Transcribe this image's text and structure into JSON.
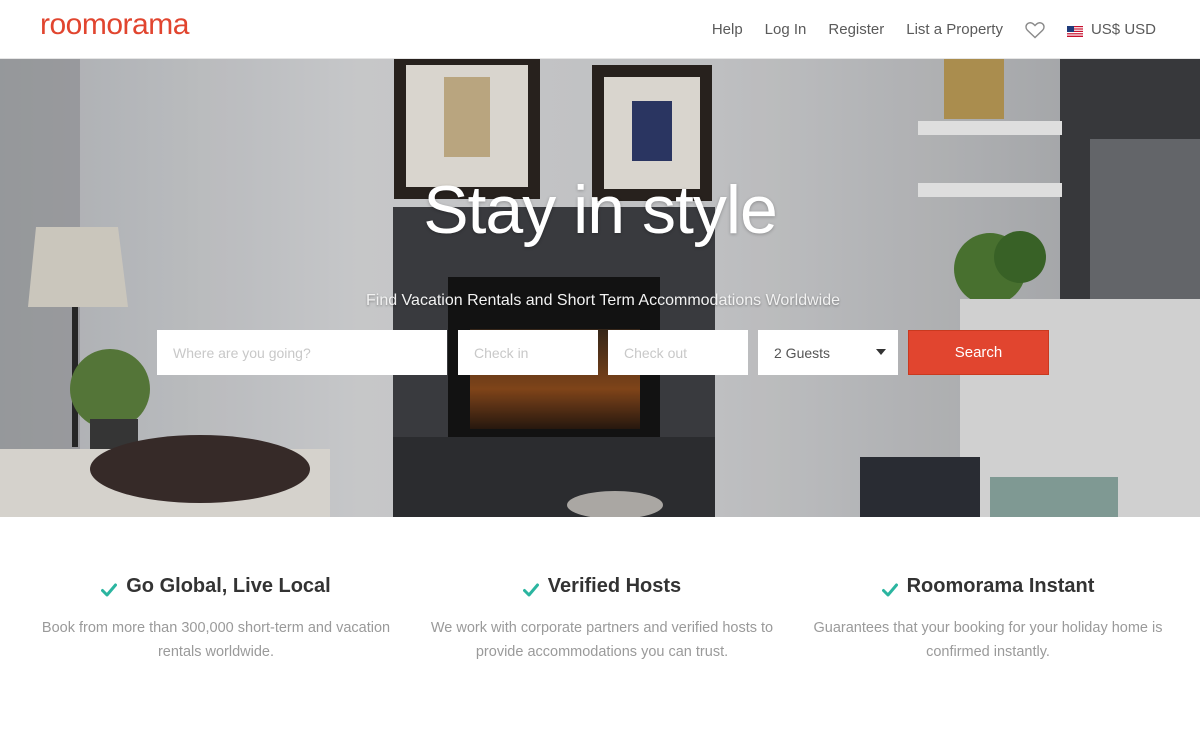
{
  "brand": {
    "logo_text": "roomorama",
    "accent_color": "#e1452f"
  },
  "nav": {
    "items": [
      "Help",
      "Log In",
      "Register",
      "List a Property"
    ],
    "wishlist_icon": "heart-icon",
    "currency_label": "US$ USD",
    "currency_flag_icon": "us-flag-icon"
  },
  "hero": {
    "title": "Stay in style",
    "subtitle": "Find Vacation Rentals and Short Term Accommodations Worldwide"
  },
  "search": {
    "where_placeholder": "Where are you going?",
    "checkin_placeholder": "Check in",
    "checkout_placeholder": "Check out",
    "guests_value": "2 Guests",
    "button_label": "Search"
  },
  "features": [
    {
      "title": "Go Global, Live Local",
      "description": "Book from more than 300,000 short-term and vacation rentals worldwide.",
      "icon": "check-icon"
    },
    {
      "title": "Verified Hosts",
      "description": "We work with corporate partners and verified hosts to provide accommodations you can trust.",
      "icon": "check-icon"
    },
    {
      "title": "Roomorama Instant",
      "description": "Guarantees that your booking for your holiday home is confirmed instantly.",
      "icon": "check-icon"
    }
  ],
  "colors": {
    "check": "#2bb5a0",
    "search_button": "#e1452f"
  }
}
